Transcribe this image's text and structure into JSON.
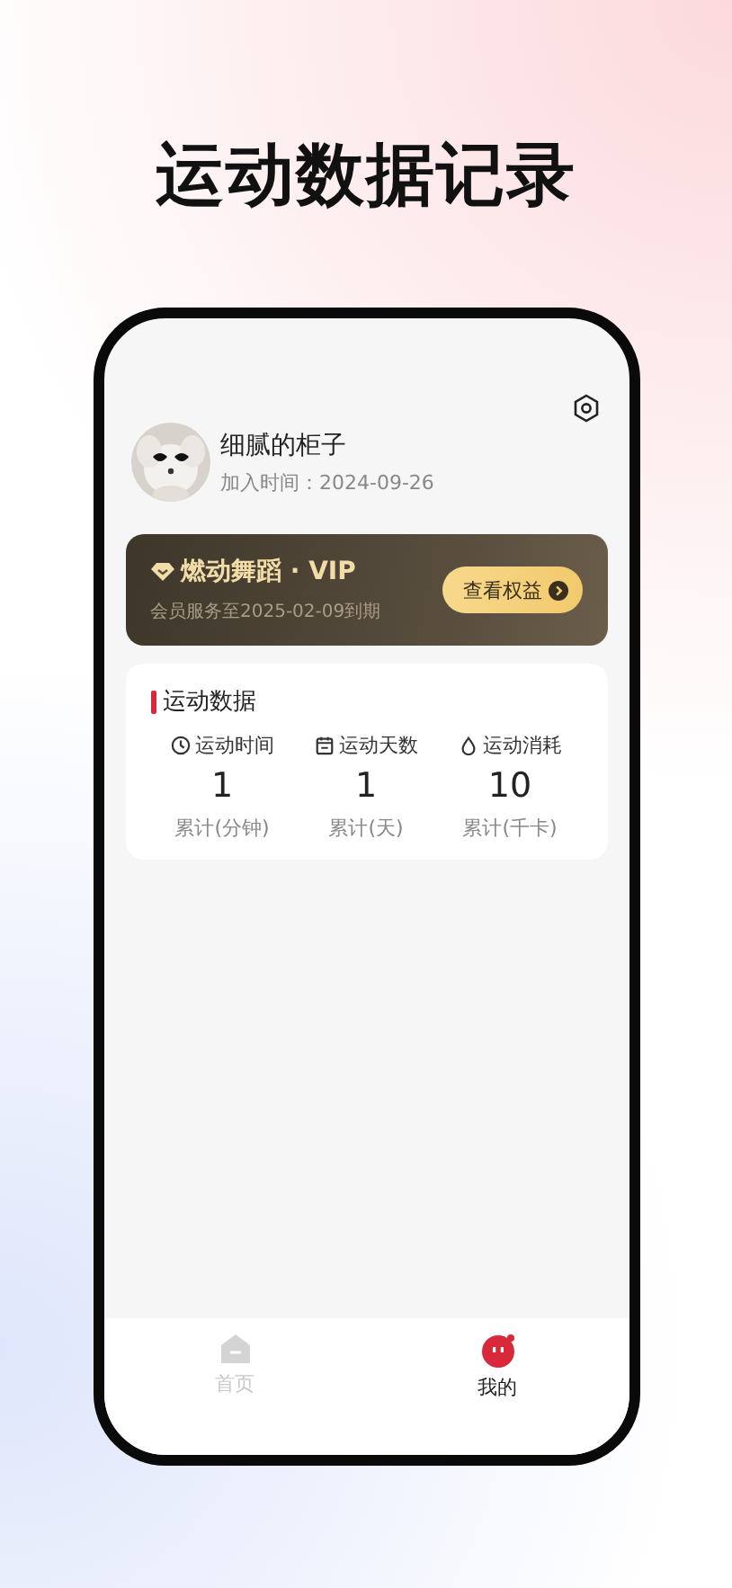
{
  "headline": "运动数据记录",
  "profile": {
    "name": "细腻的柜子",
    "joined": "加入时间：2024-09-26"
  },
  "vip": {
    "title": "燃动舞蹈 · VIP",
    "expiry": "会员服务至2025-02-09到期",
    "button": "查看权益"
  },
  "stats": {
    "title": "运动数据",
    "items": [
      {
        "kind": "time",
        "label": "运动时间",
        "value": "1",
        "unit": "累计(分钟)"
      },
      {
        "kind": "days",
        "label": "运动天数",
        "value": "1",
        "unit": "累计(天)"
      },
      {
        "kind": "calories",
        "label": "运动消耗",
        "value": "10",
        "unit": "累计(千卡)"
      }
    ]
  },
  "tabs": [
    {
      "kind": "home",
      "label": "首页",
      "selected": false
    },
    {
      "kind": "me",
      "label": "我的",
      "selected": true
    }
  ]
}
